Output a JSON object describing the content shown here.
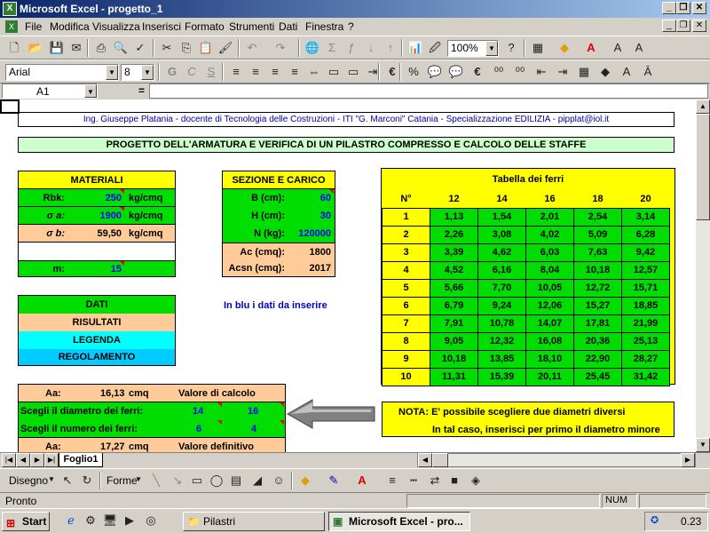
{
  "window": {
    "title": "Microsoft Excel - progetto_1",
    "icon": "excel-icon"
  },
  "menu": [
    "File",
    "Modifica",
    "Visualizza",
    "Inserisci",
    "Formato",
    "Strumenti",
    "Dati",
    "Finestra",
    "?"
  ],
  "toolbar": {
    "zoom": "100%",
    "font": "Arial",
    "size": "8"
  },
  "formula": {
    "namebox": "A1",
    "equals": "="
  },
  "sheet": {
    "credit": "Ing. Giuseppe Platania - docente di Tecnologia delle Costruzioni - ITI \"G. Marconi\" Catania - Specializzazione EDILIZIA - pipplat@iol.it",
    "title": "PROGETTO DELL'ARMATURA E VERIFICA DI UN PILASTRO COMPRESSO E CALCOLO DELLE STAFFE",
    "materiali": {
      "header": "MATERIALI",
      "rbk_label": "Rbk:",
      "rbk_value": "250",
      "rbk_unit": "kg/cmq",
      "sa_label": "σ a:",
      "sa_value": "1900",
      "sa_unit": "kg/cmq",
      "sb_label": "σ b:",
      "sb_value": "59,50",
      "sb_unit": "kg/cmq",
      "m_label": "m:",
      "m_value": "15"
    },
    "sezione": {
      "header": "SEZIONE E CARICO",
      "b_label": "B (cm):",
      "b_value": "60",
      "h_label": "H (cm):",
      "h_value": "30",
      "n_label": "N (kg):",
      "n_value": "120000",
      "ac_label": "Ac (cmq):",
      "ac_value": "1800",
      "acsn_label": "Acsn (cmq):",
      "acsn_value": "2017"
    },
    "legend": {
      "dati": "DATI",
      "risultati": "RISULTATI",
      "legenda": "LEGENDA",
      "regolamento": "REGOLAMENTO"
    },
    "blue_note": "In blu i dati da inserire",
    "tabella": {
      "title": "Tabella dei ferri",
      "n_label": "N°",
      "diameters": [
        "12",
        "14",
        "16",
        "18",
        "20"
      ],
      "rows": [
        [
          "1",
          "1,13",
          "1,54",
          "2,01",
          "2,54",
          "3,14"
        ],
        [
          "2",
          "2,26",
          "3,08",
          "4,02",
          "5,09",
          "6,28"
        ],
        [
          "3",
          "3,39",
          "4,62",
          "6,03",
          "7,63",
          "9,42"
        ],
        [
          "4",
          "4,52",
          "6,16",
          "8,04",
          "10,18",
          "12,57"
        ],
        [
          "5",
          "5,66",
          "7,70",
          "10,05",
          "12,72",
          "15,71"
        ],
        [
          "6",
          "6,79",
          "9,24",
          "12,06",
          "15,27",
          "18,85"
        ],
        [
          "7",
          "7,91",
          "10,78",
          "14,07",
          "17,81",
          "21,99"
        ],
        [
          "8",
          "9,05",
          "12,32",
          "16,08",
          "20,36",
          "25,13"
        ],
        [
          "9",
          "10,18",
          "13,85",
          "18,10",
          "22,90",
          "28,27"
        ],
        [
          "10",
          "11,31",
          "15,39",
          "20,11",
          "25,45",
          "31,42"
        ]
      ]
    },
    "calcolo": {
      "aa_label": "Aa:",
      "aa_value": "16,13",
      "aa_unit": "cmq",
      "aa_note": "Valore di calcolo",
      "diam_label": "Scegli il diametro dei ferri:",
      "diam1": "14",
      "diam2": "16",
      "num_label": "Scegli il numero dei ferri:",
      "num1": "6",
      "num2": "4",
      "aa2_label": "Aa:",
      "aa2_value": "17,27",
      "aa2_unit": "cmq",
      "aa2_note": "Valore definitivo"
    },
    "nota": {
      "line1": "NOTA:  E' possibile scegliere due diametri diversi",
      "line2": "In tal caso, inserisci per primo il diametro minore"
    }
  },
  "tabs": [
    "Foglio1"
  ],
  "drawbar": {
    "disegno": "Disegno",
    "forme": "Forme"
  },
  "status": {
    "text": "Pronto",
    "num": "NUM"
  },
  "taskbar": {
    "start": "Start",
    "task1": "Pilastri",
    "task2": "Microsoft Excel - pro...",
    "clock": "0.23"
  },
  "colors": {
    "green": "#00dd00",
    "salmon": "#ffcc99",
    "yellow": "#ffff00",
    "cyan": "#00ffff",
    "sky": "#00ccff",
    "titlebar": "#0a246a"
  }
}
